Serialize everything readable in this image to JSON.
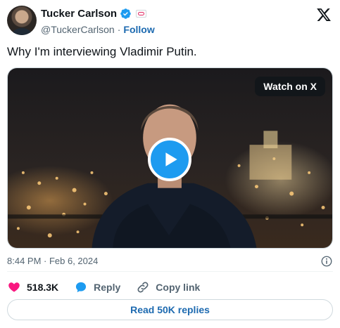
{
  "author": {
    "name": "Tucker Carlson",
    "handle": "@TuckerCarlson",
    "separator": "·",
    "follow_label": "Follow"
  },
  "tweet": {
    "text": "Why I'm interviewing Vladimir Putin."
  },
  "media": {
    "watch_label": "Watch on X"
  },
  "meta": {
    "timestamp": "8:44 PM · Feb 6, 2024"
  },
  "actions": {
    "likes": "518.3K",
    "reply_label": "Reply",
    "copy_link_label": "Copy link"
  },
  "replies_button": {
    "label": "Read 50K replies"
  },
  "colors": {
    "accent": "#1d9bf0",
    "link": "#1d6ab0",
    "like": "#f91880"
  },
  "icons": [
    "verified-badge-icon",
    "x-logo-icon",
    "play-icon",
    "info-icon",
    "heart-icon",
    "reply-bubble-icon",
    "link-icon"
  ]
}
